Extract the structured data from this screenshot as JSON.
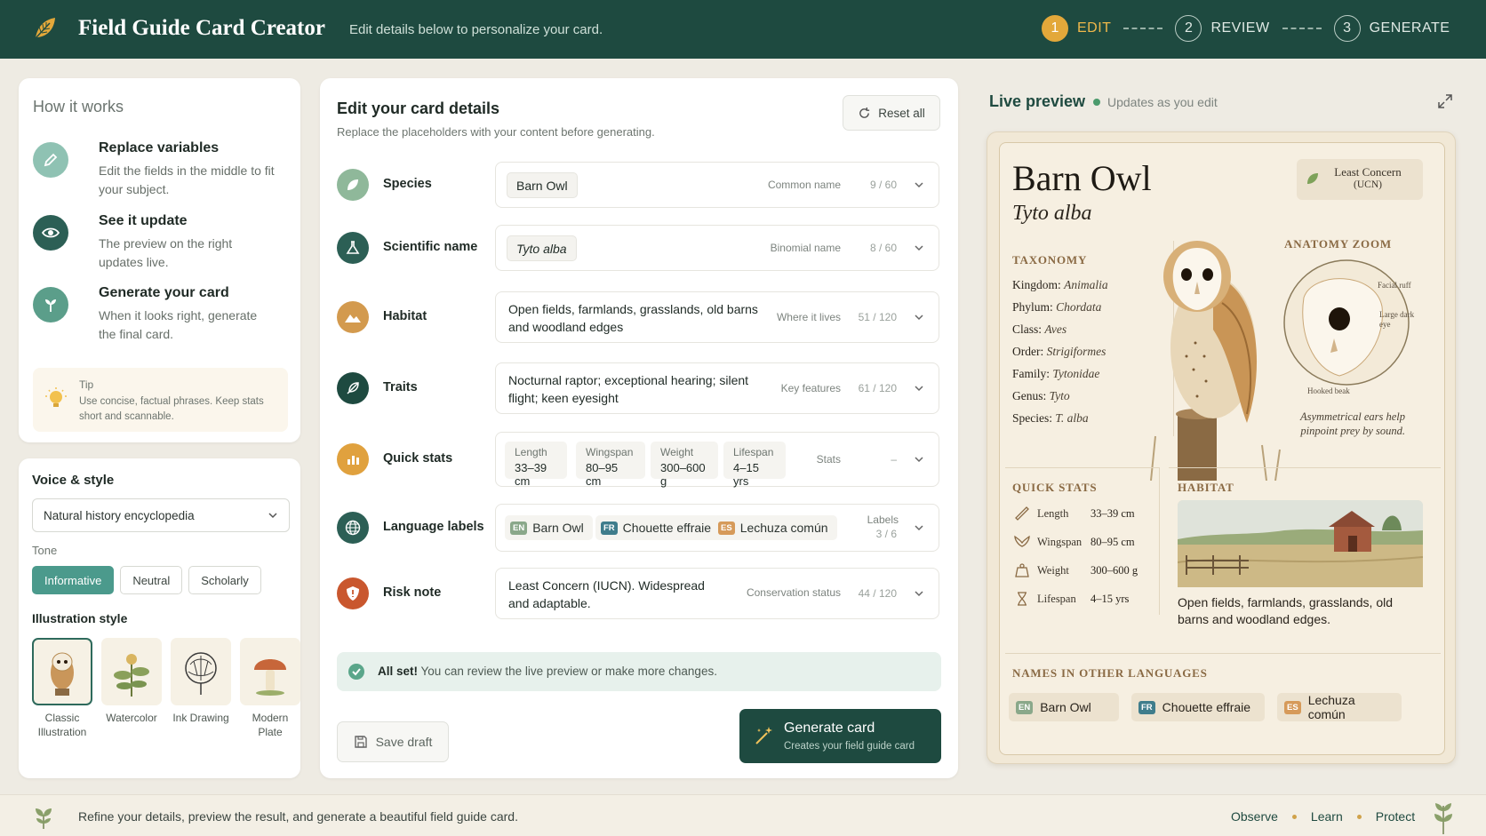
{
  "header": {
    "app_title": "Field Guide Card Creator",
    "subtitle": "Edit details below to personalize your card.",
    "steps": [
      {
        "num": "1",
        "label": "EDIT",
        "active": true
      },
      {
        "num": "2",
        "label": "REVIEW",
        "active": false
      },
      {
        "num": "3",
        "label": "GENERATE",
        "active": false
      }
    ]
  },
  "how": {
    "title": "How it works",
    "steps": [
      {
        "title": "Replace variables",
        "desc": "Edit the fields in the middle to fit your subject.",
        "icon": "pencil-icon"
      },
      {
        "title": "See it update",
        "desc": "The preview on the right updates live.",
        "icon": "eye-icon"
      },
      {
        "title": "Generate your card",
        "desc": "When it looks right, generate the final card.",
        "icon": "sprout-icon"
      }
    ],
    "tip_label": "Tip",
    "tip_text": "Use concise, factual phrases. Keep stats short and scannable."
  },
  "voice": {
    "title": "Voice & style",
    "selected": "Natural history encyclopedia",
    "tone_label": "Tone",
    "tones": [
      "Informative",
      "Neutral",
      "Scholarly"
    ],
    "active_tone": "Informative",
    "illustration_label": "Illustration style",
    "illustrations": [
      {
        "name": "Classic Illustration",
        "active": true
      },
      {
        "name": "Watercolor",
        "active": false
      },
      {
        "name": "Ink Drawing",
        "active": false
      },
      {
        "name": "Modern Plate",
        "active": false
      }
    ]
  },
  "editor": {
    "title": "Edit your card details",
    "subtitle": "Replace the placeholders with your content before generating.",
    "reset_label": "Reset all",
    "fields": {
      "species": {
        "label": "Species",
        "value": "Barn Owl",
        "hint": "Common name",
        "count": "9 / 60"
      },
      "scientific": {
        "label": "Scientific name",
        "value": "Tyto alba",
        "hint": "Binomial name",
        "count": "8 / 60"
      },
      "habitat": {
        "label": "Habitat",
        "value": "Open fields, farmlands, grasslands, old barns and woodland edges",
        "hint": "Where it lives",
        "count": "51 / 120"
      },
      "traits": {
        "label": "Traits",
        "value": "Nocturnal raptor; exceptional hearing; silent flight; keen eyesight",
        "hint": "Key features",
        "count": "61 / 120"
      },
      "stats": {
        "label": "Quick stats",
        "hint": "Stats",
        "count": "–",
        "items": [
          {
            "k": "Length",
            "v": "33–39 cm"
          },
          {
            "k": "Wingspan",
            "v": "80–95 cm"
          },
          {
            "k": "Weight",
            "v": "300–600 g"
          },
          {
            "k": "Lifespan",
            "v": "4–15 yrs"
          }
        ]
      },
      "languages": {
        "label": "Language labels",
        "hint": "Labels",
        "count": "3 / 6",
        "items": [
          {
            "code": "EN",
            "name": "Barn Owl",
            "color": "#8aa88a"
          },
          {
            "code": "FR",
            "name": "Chouette effraie",
            "color": "#3f7d8c"
          },
          {
            "code": "ES",
            "name": "Lechuza común",
            "color": "#d69a5a"
          }
        ]
      },
      "risk": {
        "label": "Risk note",
        "value": "Least Concern (IUCN). Widespread and adaptable.",
        "hint": "Conservation status",
        "count": "44 / 120"
      }
    },
    "allset_bold": "All set!",
    "allset_text": "You can review the live preview or make more changes.",
    "save_label": "Save draft",
    "generate_label": "Generate card",
    "generate_sub": "Creates your field guide card"
  },
  "preview": {
    "title": "Live preview",
    "status": "Updates as you edit",
    "card": {
      "name": "Barn Owl",
      "scientific": "Tyto alba",
      "status_line1": "Least Concern",
      "status_line2": "(UCN)",
      "taxonomy_title": "TAXONOMY",
      "taxonomy": [
        {
          "k": "Kingdom:",
          "v": "Animalia"
        },
        {
          "k": "Phylum:",
          "v": "Chordata"
        },
        {
          "k": "Class:",
          "v": "Aves"
        },
        {
          "k": "Order:",
          "v": "Strigiformes"
        },
        {
          "k": "Family:",
          "v": "Tytonidae"
        },
        {
          "k": "Genus:",
          "v": "Tyto"
        },
        {
          "k": "Species:",
          "v": "T. alba"
        }
      ],
      "anatomy_title": "ANATOMY ZOOM",
      "anatomy_labels": [
        "Facial ruff",
        "Large dark eye",
        "Hooked beak"
      ],
      "anatomy_note": "Asymmetrical ears help pinpoint prey by sound.",
      "quick_stats_title": "QUICK STATS",
      "quick_stats": [
        {
          "k": "Length",
          "v": "33–39 cm",
          "icon": "ruler-icon"
        },
        {
          "k": "Wingspan",
          "v": "80–95 cm",
          "icon": "wing-icon"
        },
        {
          "k": "Weight",
          "v": "300–600 g",
          "icon": "weight-icon"
        },
        {
          "k": "Lifespan",
          "v": "4–15 yrs",
          "icon": "hourglass-icon"
        }
      ],
      "habitat_title": "HABITAT",
      "habitat_text": "Open fields, farmlands, grasslands, old barns and woodland edges.",
      "names_title": "NAMES IN OTHER LANGUAGES",
      "names": [
        {
          "code": "EN",
          "name": "Barn Owl",
          "color": "#8aa88a"
        },
        {
          "code": "FR",
          "name": "Chouette effraie",
          "color": "#3f7d8c"
        },
        {
          "code": "ES",
          "name": "Lechuza común",
          "color": "#d69a5a"
        }
      ]
    }
  },
  "footer": {
    "text": "Refine your details, preview the result, and generate a beautiful field guide card.",
    "links": [
      "Observe",
      "Learn",
      "Protect"
    ]
  }
}
